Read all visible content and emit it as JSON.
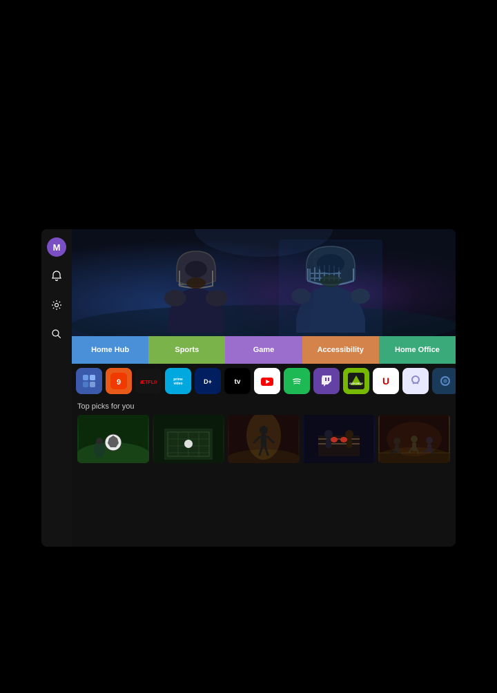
{
  "sidebar": {
    "user_initial": "M",
    "icons": [
      {
        "name": "user-avatar",
        "symbol": "M"
      },
      {
        "name": "notification-icon",
        "symbol": "🔔"
      },
      {
        "name": "settings-icon",
        "symbol": "⚙"
      },
      {
        "name": "search-icon",
        "symbol": "🔍"
      }
    ]
  },
  "nav": {
    "buttons": [
      {
        "id": "home-hub",
        "label": "Home Hub",
        "class": "home-hub"
      },
      {
        "id": "sports",
        "label": "Sports",
        "class": "sports"
      },
      {
        "id": "game",
        "label": "Game",
        "class": "game"
      },
      {
        "id": "accessibility",
        "label": "Accessibility",
        "class": "accessibility"
      },
      {
        "id": "home-office",
        "label": "Home Office",
        "class": "home-office"
      }
    ]
  },
  "apps": [
    {
      "id": "apps",
      "label": "APPS",
      "class": "app-apps"
    },
    {
      "id": "lg-store",
      "label": "9",
      "class": "app-store"
    },
    {
      "id": "netflix",
      "label": "NETFLIX",
      "class": "app-netflix"
    },
    {
      "id": "prime-video",
      "label": "prime video",
      "class": "app-prime"
    },
    {
      "id": "disney-plus",
      "label": "D+",
      "class": "app-disney"
    },
    {
      "id": "apple-tv",
      "label": "🍎",
      "class": "app-appletv"
    },
    {
      "id": "youtube",
      "label": "YT",
      "class": "app-youtube"
    },
    {
      "id": "spotify",
      "label": "♪",
      "class": "app-spotify"
    },
    {
      "id": "twitch",
      "label": "twitch",
      "class": "app-twitch"
    },
    {
      "id": "geforce-now",
      "label": "GFN",
      "class": "app-geforce"
    },
    {
      "id": "uscreen",
      "label": "U",
      "class": "app-u"
    },
    {
      "id": "app-circle",
      "label": "◎",
      "class": "app-circle"
    },
    {
      "id": "app-ring",
      "label": "○",
      "class": "app-ring"
    },
    {
      "id": "app-screen",
      "label": "▣",
      "class": "app-screen"
    },
    {
      "id": "app-more",
      "label": "≡",
      "class": "app-more"
    }
  ],
  "top_picks": {
    "label": "Top picks for you",
    "cards": [
      {
        "id": "pick-1",
        "class": "pick-card-1"
      },
      {
        "id": "pick-2",
        "class": "pick-card-2"
      },
      {
        "id": "pick-3",
        "class": "pick-card-3"
      },
      {
        "id": "pick-4",
        "class": "pick-card-4"
      },
      {
        "id": "pick-5",
        "class": "pick-card-5"
      }
    ]
  },
  "colors": {
    "home_hub": "#4a90d9",
    "sports": "#7ab34a",
    "game": "#9b6dcc",
    "accessibility": "#d4834a",
    "home_office": "#3aaa7a"
  }
}
